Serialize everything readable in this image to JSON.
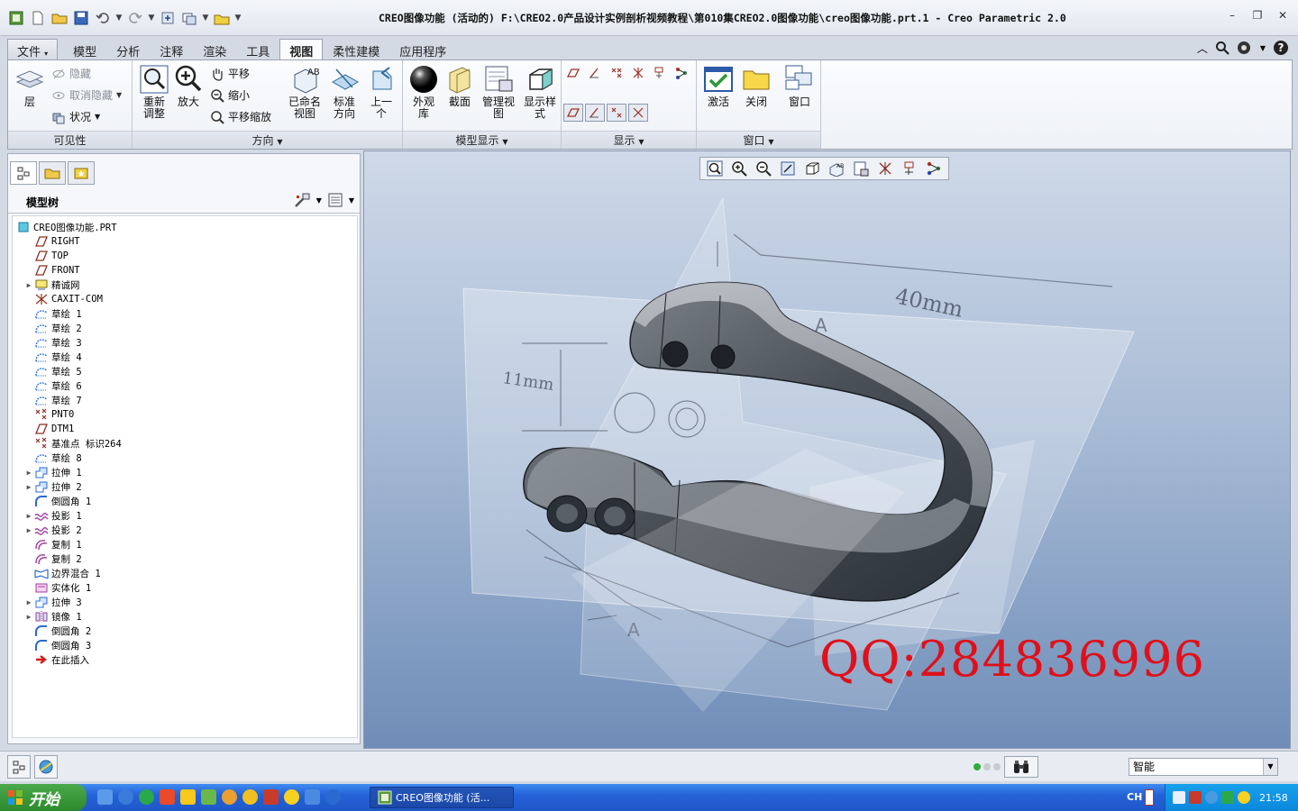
{
  "window": {
    "title": "CREO图像功能 (活动的) F:\\CREO2.0产品设计实例剖析视频教程\\第010集CREO2.0图像功能\\creo图像功能.prt.1 - Creo Parametric 2.0"
  },
  "tabs": [
    {
      "label": "文件"
    },
    {
      "label": "模型"
    },
    {
      "label": "分析"
    },
    {
      "label": "注释"
    },
    {
      "label": "渲染"
    },
    {
      "label": "工具"
    },
    {
      "label": "视图"
    },
    {
      "label": "柔性建模"
    },
    {
      "label": "应用程序"
    }
  ],
  "ribbon": {
    "visibility": {
      "label": "可见性",
      "layer": "层",
      "hide": "隐藏",
      "unhide": "取消隐藏",
      "status": "状况"
    },
    "orientation": {
      "label": "方向",
      "refit": "重新\n调整",
      "zoom_in": "放大",
      "pan": "平移",
      "zoom_out": "缩小",
      "pan_zoom": "平移缩放",
      "named_views": "已命名\n视图",
      "standard": "标准\n方向",
      "previous": "上一\n个"
    },
    "model_display": {
      "label": "模型显示",
      "appearance": "外观\n库",
      "section": "截面",
      "manage_views": "管理视\n图",
      "display_style": "显示样\n式"
    },
    "show": {
      "label": "显示"
    },
    "window": {
      "label": "窗口",
      "activate": "激活",
      "close": "关闭",
      "windows": "窗口"
    }
  },
  "model_tree": {
    "title": "模型树",
    "items": [
      {
        "label": "CREO图像功能.PRT",
        "icon": "part-icon",
        "expand": false,
        "root": true
      },
      {
        "label": "RIGHT",
        "icon": "datum-plane-icon",
        "expand": false
      },
      {
        "label": "TOP",
        "icon": "datum-plane-icon",
        "expand": false
      },
      {
        "label": "FRONT",
        "icon": "datum-plane-icon",
        "expand": false
      },
      {
        "label": "精诚网",
        "icon": "image-icon",
        "expand": true
      },
      {
        "label": "CAXIT-COM",
        "icon": "csys-icon",
        "expand": false
      },
      {
        "label": "草绘 1",
        "icon": "sketch-icon",
        "expand": false
      },
      {
        "label": "草绘 2",
        "icon": "sketch-icon",
        "expand": false
      },
      {
        "label": "草绘 3",
        "icon": "sketch-icon",
        "expand": false
      },
      {
        "label": "草绘 4",
        "icon": "sketch-icon",
        "expand": false
      },
      {
        "label": "草绘 5",
        "icon": "sketch-icon",
        "expand": false
      },
      {
        "label": "草绘 6",
        "icon": "sketch-icon",
        "expand": false
      },
      {
        "label": "草绘 7",
        "icon": "sketch-icon",
        "expand": false
      },
      {
        "label": "PNT0",
        "icon": "datum-point-icon",
        "expand": false
      },
      {
        "label": "DTM1",
        "icon": "datum-plane-icon",
        "expand": false
      },
      {
        "label": "基准点 标识264",
        "icon": "datum-point-icon",
        "expand": false
      },
      {
        "label": "草绘 8",
        "icon": "sketch-icon",
        "expand": false
      },
      {
        "label": "拉伸 1",
        "icon": "extrude-icon",
        "expand": true
      },
      {
        "label": "拉伸 2",
        "icon": "extrude-icon",
        "expand": true
      },
      {
        "label": "倒圆角 1",
        "icon": "round-icon",
        "expand": false
      },
      {
        "label": "投影 1",
        "icon": "projection-icon",
        "expand": true
      },
      {
        "label": "投影 2",
        "icon": "projection-icon",
        "expand": true
      },
      {
        "label": "复制 1",
        "icon": "copy-icon",
        "expand": false
      },
      {
        "label": "复制 2",
        "icon": "copy-icon",
        "expand": false
      },
      {
        "label": "边界混合 1",
        "icon": "boundary-blend-icon",
        "expand": false
      },
      {
        "label": "实体化 1",
        "icon": "solidify-icon",
        "expand": false
      },
      {
        "label": "拉伸 3",
        "icon": "extrude-icon",
        "expand": true
      },
      {
        "label": "镜像 1",
        "icon": "mirror-icon",
        "expand": true
      },
      {
        "label": "倒圆角 2",
        "icon": "round-icon",
        "expand": false
      },
      {
        "label": "倒圆角 3",
        "icon": "round-icon",
        "expand": false
      },
      {
        "label": "在此插入",
        "icon": "insert-here-icon",
        "expand": false
      }
    ]
  },
  "viewport": {
    "watermark": "QQ:284836996",
    "sketch_dim_1": "40mm",
    "sketch_dim_2": "11mm",
    "sketch_label_a1": "A",
    "sketch_label_a2": "A"
  },
  "statusbar": {
    "filter_value": "智能"
  },
  "taskbar": {
    "start_label": "开始",
    "task_label": "CREO图像功能 (活...",
    "lang": "CH",
    "clock": "21:58"
  },
  "colors": {
    "watermark": "#e0101a",
    "viewport_top": "#cfd9e8",
    "viewport_bottom": "#6f8db8",
    "taskbar": "#2462d8"
  }
}
